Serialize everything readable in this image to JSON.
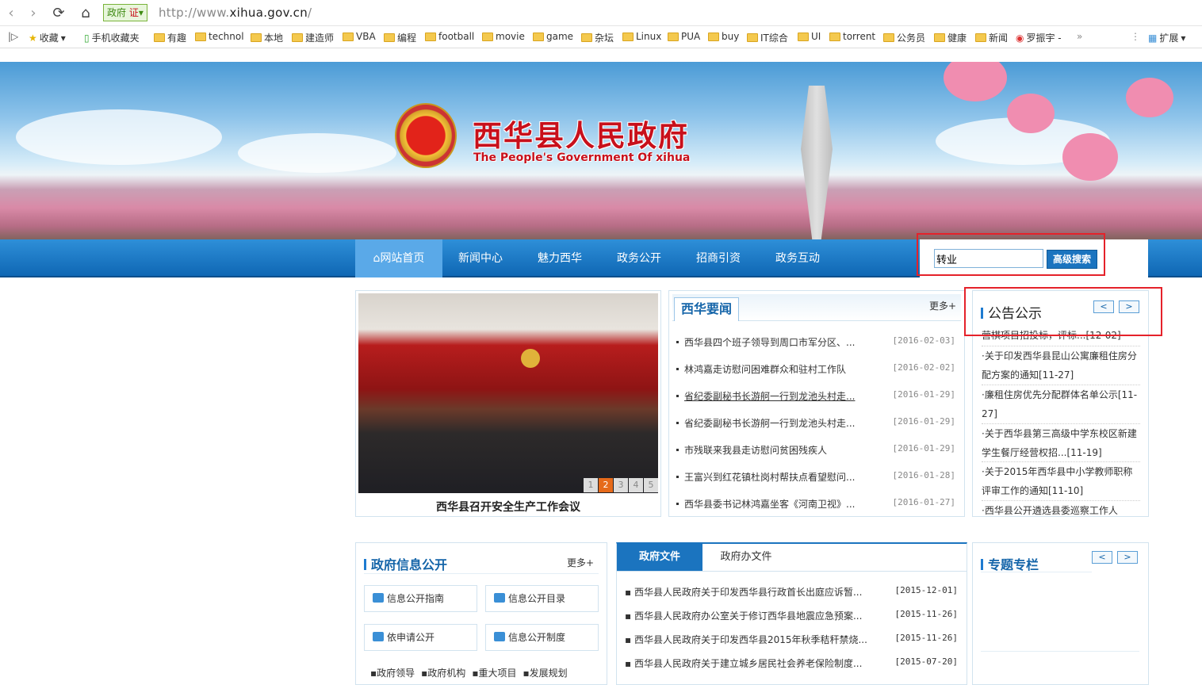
{
  "browser": {
    "cert_label": "政府",
    "cert_mark": "证",
    "url_prefix": "http://www.",
    "url_host": "xihua.gov.cn",
    "url_suffix": "/",
    "bookmarks": [
      "收藏",
      "手机收藏夹",
      "有趣",
      "technol",
      "本地",
      "建造师",
      "VBA",
      "编程",
      "football",
      "movie",
      "game",
      "杂坛",
      "Linux",
      "PUA",
      "buy",
      "IT综合",
      "UI",
      "torrent",
      "公务员",
      "健康",
      "新闻",
      "罗振宇 -"
    ],
    "overflow_label": "»",
    "extensions_label": "扩展"
  },
  "banner": {
    "title": "西华县人民政府",
    "subtitle": "The People's Government Of xihua"
  },
  "nav": {
    "items": [
      "网站首页",
      "新闻中心",
      "魅力西华",
      "政务公开",
      "招商引资",
      "政务互动"
    ]
  },
  "search": {
    "value": "转业",
    "button_label": "高级搜索"
  },
  "slideshow": {
    "caption": "西华县召开安全生产工作会议",
    "pages": [
      "1",
      "2",
      "3",
      "4",
      "5"
    ],
    "active_page": "2"
  },
  "news": {
    "title": "西华要闻",
    "more": "更多+",
    "items": [
      {
        "text": "西华县四个班子领导到周口市军分区、...",
        "date": "[2016-02-03]"
      },
      {
        "text": "林鸿嘉走访慰问困难群众和驻村工作队",
        "date": "[2016-02-02]"
      },
      {
        "text": "省纪委副秘书长游舸一行到龙池头村走...",
        "date": "[2016-01-29]"
      },
      {
        "text": "省纪委副秘书长游舸一行到龙池头村走...",
        "date": "[2016-01-29]"
      },
      {
        "text": "市残联来我县走访慰问贫困残疾人",
        "date": "[2016-01-29]"
      },
      {
        "text": "王富兴到红花镇杜岗村帮扶点看望慰问...",
        "date": "[2016-01-28]"
      },
      {
        "text": "西华县委书记林鸿嘉坐客《河南卫视》...",
        "date": "[2016-01-27]"
      }
    ]
  },
  "notices": {
    "title": "公告公示",
    "prev": "<",
    "next": ">",
    "items": [
      "营棋项目招投标，评标...[12-02]",
      "·关于印发西华县昆山公寓廉租住房分配方案的通知[11-27]",
      "·廉租住房优先分配群体名单公示[11-27]",
      "·关于西华县第三高级中学东校区新建学生餐厅经营权招...[11-19]",
      "·关于2015年西华县中小学教师职称评审工作的通知[11-10]",
      "·西华县公开遴选县委巡察工作人"
    ]
  },
  "gov_info": {
    "title": "政府信息公开",
    "more": "更多+",
    "buttons": [
      "信息公开指南",
      "信息公开目录",
      "依申请公开",
      "信息公开制度"
    ],
    "links": [
      "政府领导",
      "政府机构",
      "重大项目",
      "发展规划"
    ]
  },
  "documents": {
    "tabs": [
      "政府文件",
      "政府办文件"
    ],
    "items": [
      {
        "text": "西华县人民政府关于印发西华县行政首长出庭应诉暂...",
        "date": "[2015-12-01]"
      },
      {
        "text": "西华县人民政府办公室关于修订西华县地震应急预案...",
        "date": "[2015-11-26]"
      },
      {
        "text": "西华县人民政府关于印发西华县2015年秋季秸秆禁烧...",
        "date": "[2015-11-26]"
      },
      {
        "text": "西华县人民政府关于建立城乡居民社会养老保险制度...",
        "date": "[2015-07-20]"
      }
    ]
  },
  "special": {
    "title": "专题专栏",
    "prev": "<",
    "next": ">"
  },
  "colors": {
    "nav_blue": "#1473c2",
    "title_red": "#c8101b",
    "highlight_red": "#e5222a"
  }
}
